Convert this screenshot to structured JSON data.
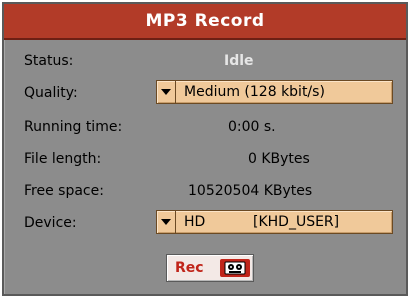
{
  "dialog": {
    "title": "MP3 Record"
  },
  "fields": {
    "status_label": "Status:",
    "status_value": "Idle",
    "quality_label": "Quality:",
    "quality_value": "Medium (128 kbit/s)",
    "running_time_label": "Running time:",
    "running_time_value": "0:00 s.",
    "file_length_label": "File length:",
    "file_length_value": "0 KBytes",
    "free_space_label": "Free space:",
    "free_space_value": "10520504 KBytes",
    "device_label": "Device:",
    "device_value": "HD",
    "device_path": "[KHD_USER]"
  },
  "buttons": {
    "rec_label": "Rec",
    "rec_icon": "tape-recorder-icon"
  },
  "colors": {
    "title_bar": "#b23b28",
    "dialog_bg": "#8c8c8c",
    "select_bg": "#f0c99a",
    "rec_red": "#c0251a"
  }
}
